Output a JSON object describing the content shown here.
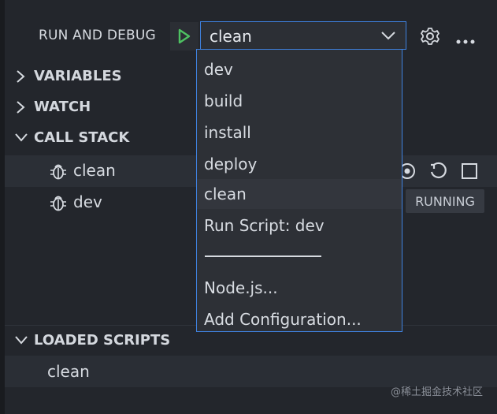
{
  "header": {
    "title": "RUN AND DEBUG",
    "config_value": "clean"
  },
  "sections": {
    "variables": "VARIABLES",
    "watch": "WATCH",
    "call_stack": "CALL STACK",
    "loaded_scripts": "LOADED SCRIPTS"
  },
  "call_stack": {
    "items": [
      {
        "label": "clean"
      },
      {
        "label": "dev"
      }
    ],
    "badge": "RUNNING"
  },
  "loaded_scripts": {
    "items": [
      {
        "label": "clean"
      }
    ]
  },
  "dropdown": {
    "items": [
      {
        "label": "dev"
      },
      {
        "label": "build"
      },
      {
        "label": "install"
      },
      {
        "label": "deploy"
      },
      {
        "label": "clean"
      },
      {
        "label": "Run Script: dev"
      },
      {
        "label": "Node.js..."
      },
      {
        "label": "Add Configuration..."
      }
    ]
  },
  "footer": {
    "watermark": "@稀土掘金技术社区"
  },
  "colors": {
    "accent": "#3f82e0",
    "play": "#4ec162",
    "panel": "#23262c"
  },
  "icons": {
    "play": "play-icon",
    "chevron": "chevron-down-icon",
    "gear": "gear-icon",
    "more": "more-icon",
    "bug": "bug-icon",
    "continue": "continue-icon",
    "restart": "restart-icon",
    "stop": "stop-icon"
  }
}
